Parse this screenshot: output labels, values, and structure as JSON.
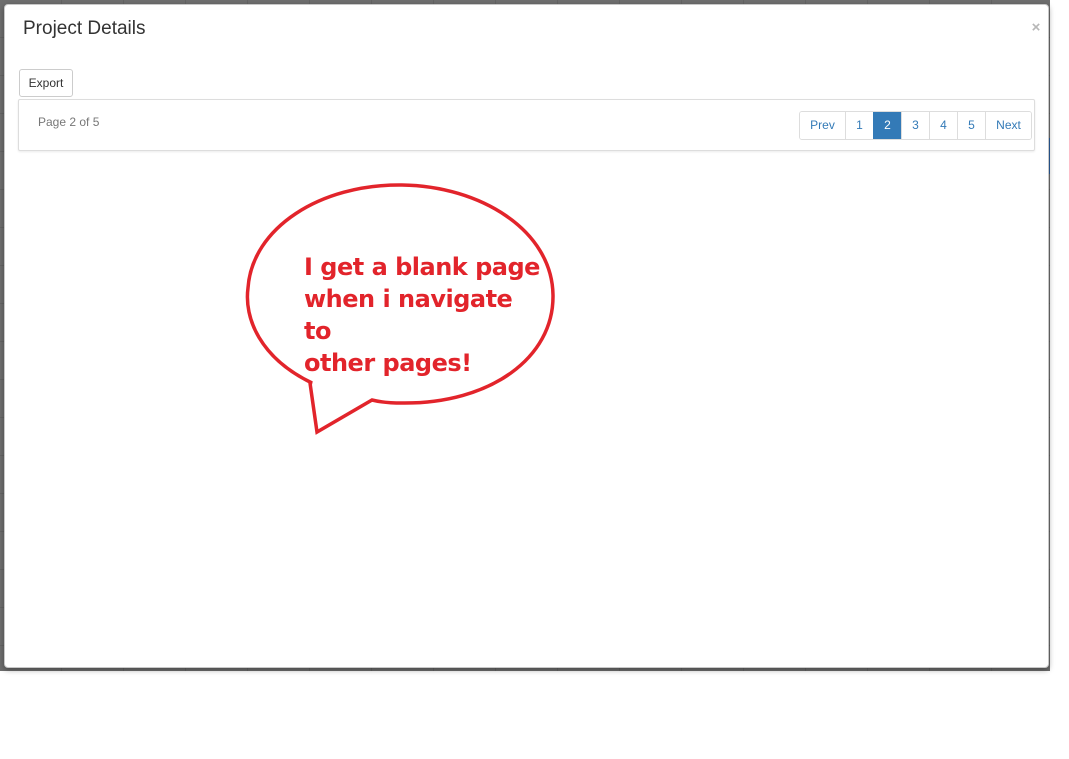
{
  "modal": {
    "title": "Project Details",
    "close_label": "×",
    "export_label": "Export"
  },
  "pager": {
    "status": "Page 2 of 5",
    "prev_label": "Prev",
    "next_label": "Next",
    "pages": [
      "1",
      "2",
      "3",
      "4",
      "5"
    ],
    "active_page": "2"
  },
  "annotation": {
    "lines": [
      "I get a blank page",
      "when i navigate to",
      "other pages!"
    ],
    "color": "#e2242b"
  },
  "colors": {
    "accent": "#337ab7",
    "annotation_red": "#e2242b"
  }
}
